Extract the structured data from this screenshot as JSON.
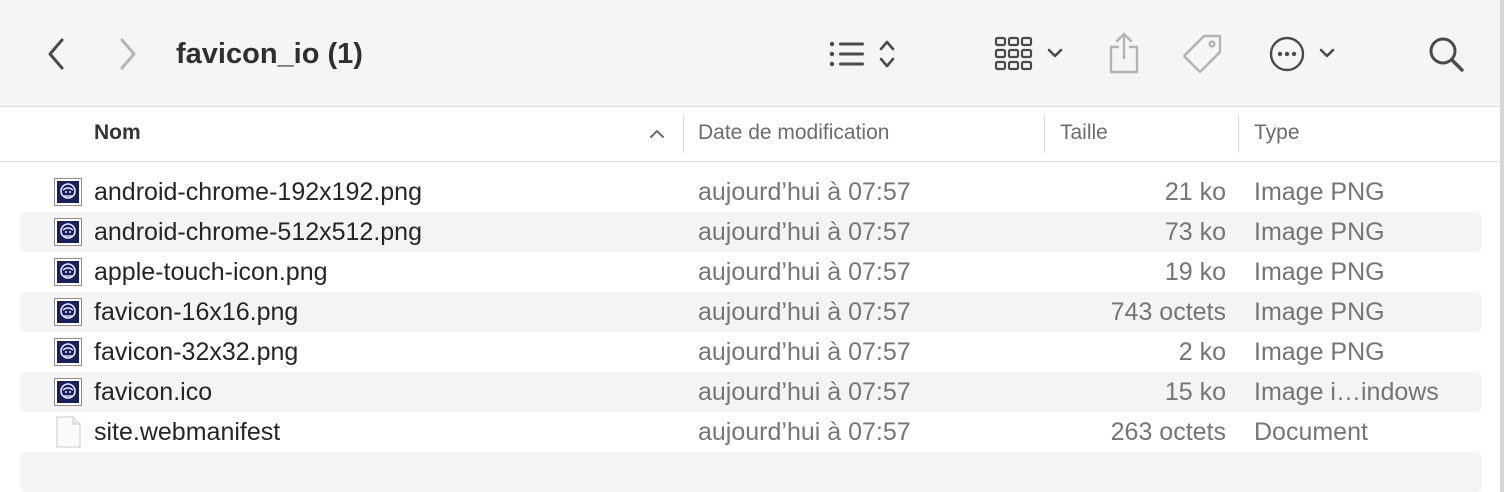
{
  "toolbar": {
    "title": "favicon_io (1)",
    "back_icon": "chevron-left-icon",
    "forward_icon": "chevron-right-icon",
    "list_view_icon": "list-view-icon",
    "grid_view_icon": "grid-view-icon",
    "share_icon": "share-icon",
    "tag_icon": "tag-icon",
    "more_icon": "ellipsis-circle-icon",
    "search_icon": "search-icon"
  },
  "columns": {
    "name": "Nom",
    "date": "Date de modification",
    "size": "Taille",
    "type": "Type",
    "sort": "ascending"
  },
  "files": [
    {
      "name": "android-chrome-192x192.png",
      "date": "aujourd’hui à 07:57",
      "size": "21 ko",
      "type": "Image PNG",
      "icon": "png-image-icon"
    },
    {
      "name": "android-chrome-512x512.png",
      "date": "aujourd’hui à 07:57",
      "size": "73 ko",
      "type": "Image PNG",
      "icon": "png-image-icon"
    },
    {
      "name": "apple-touch-icon.png",
      "date": "aujourd’hui à 07:57",
      "size": "19 ko",
      "type": "Image PNG",
      "icon": "png-image-icon"
    },
    {
      "name": "favicon-16x16.png",
      "date": "aujourd’hui à 07:57",
      "size": "743 octets",
      "type": "Image PNG",
      "icon": "png-image-icon"
    },
    {
      "name": "favicon-32x32.png",
      "date": "aujourd’hui à 07:57",
      "size": "2 ko",
      "type": "Image PNG",
      "icon": "png-image-icon"
    },
    {
      "name": "favicon.ico",
      "date": "aujourd’hui à 07:57",
      "size": "15 ko",
      "type": "Image i…indows",
      "icon": "ico-image-icon"
    },
    {
      "name": "site.webmanifest",
      "date": "aujourd’hui à 07:57",
      "size": "263 octets",
      "type": "Document",
      "icon": "document-icon"
    }
  ]
}
